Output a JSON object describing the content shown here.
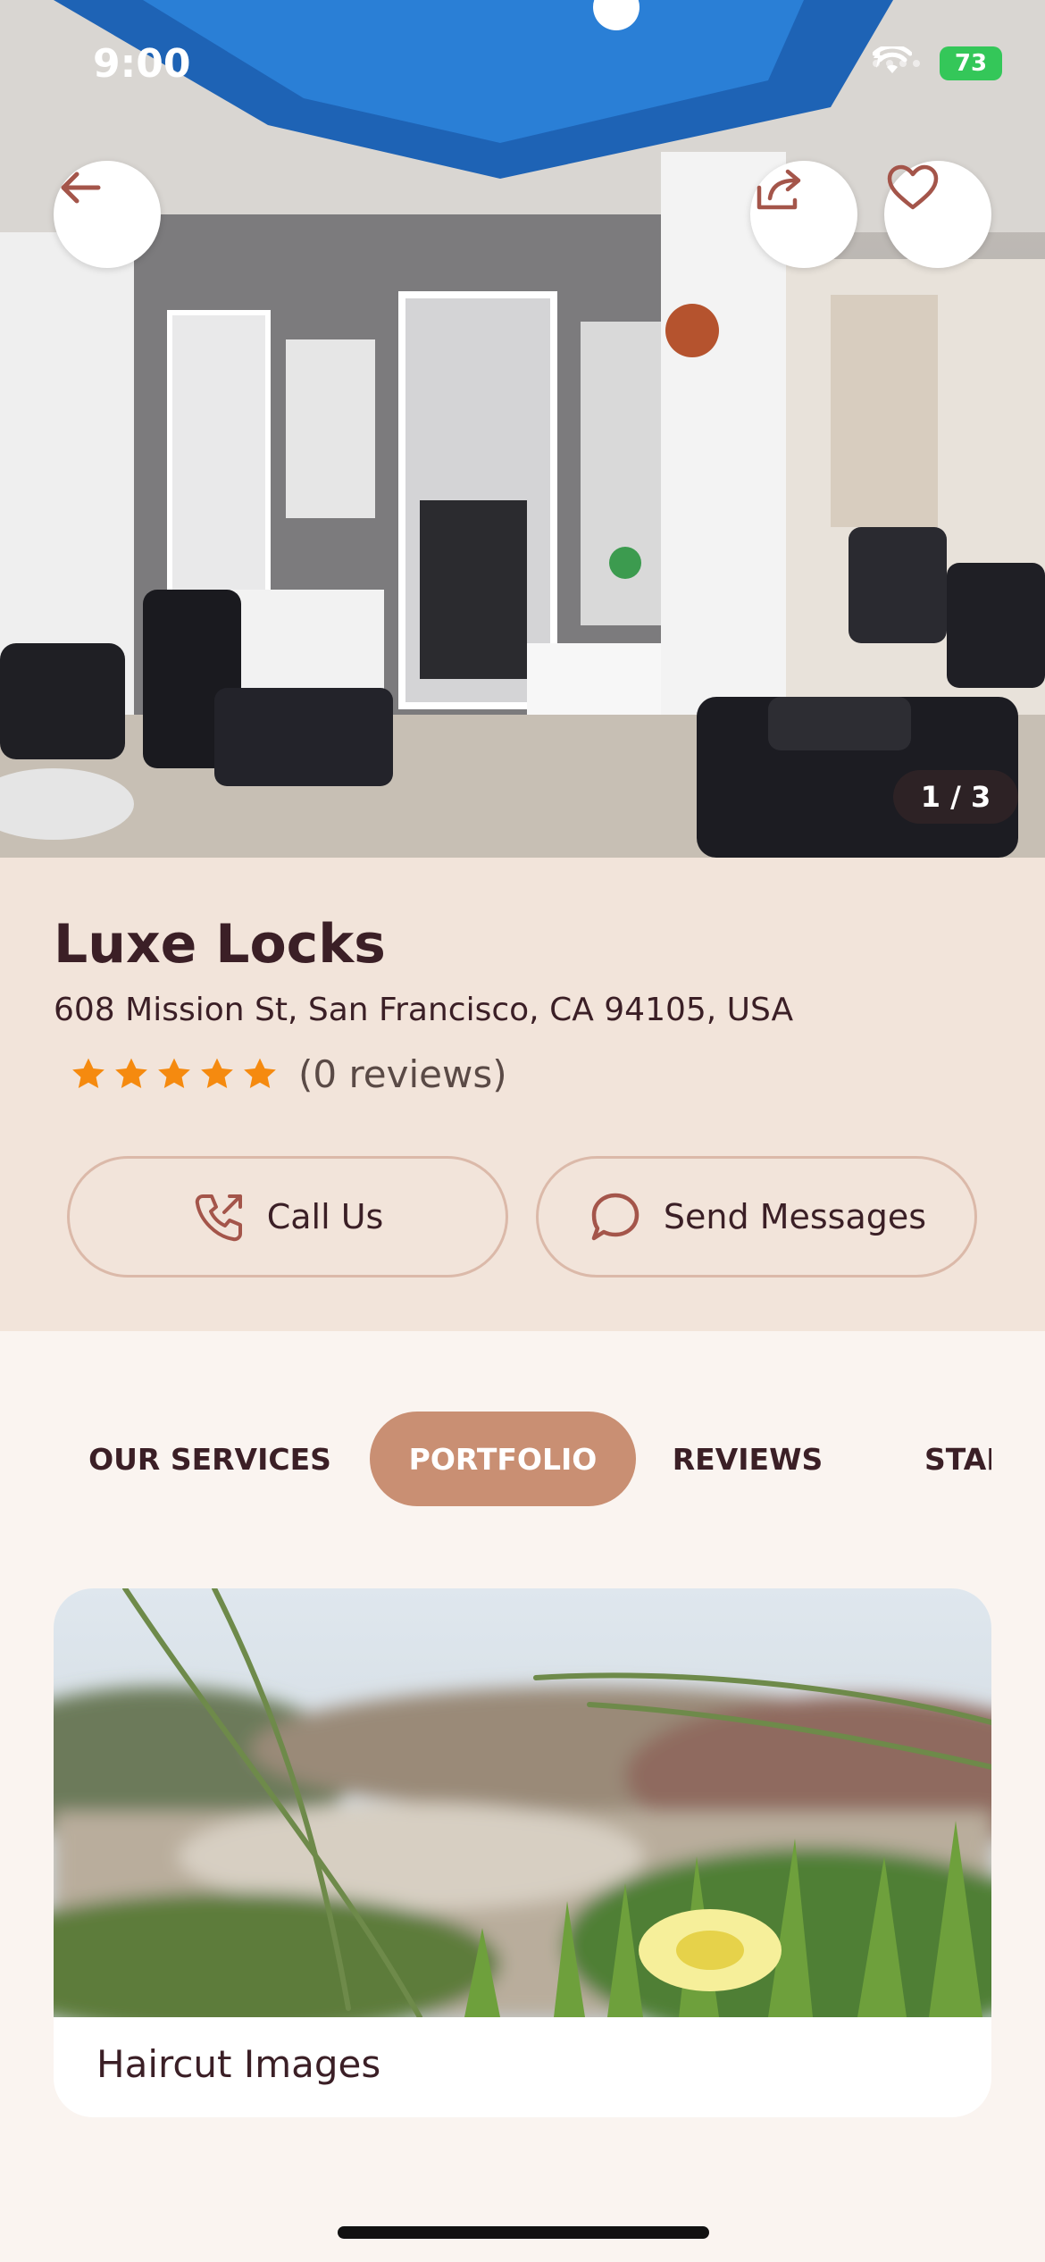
{
  "status_bar": {
    "time": "9:00",
    "battery": "73"
  },
  "hero": {
    "photo_counter": "1 / 3",
    "back_icon": "arrow-left-icon",
    "share_icon": "share-icon",
    "favorite_icon": "heart-icon"
  },
  "shop": {
    "name": "Luxe Locks",
    "address": "608 Mission St, San Francisco, CA 94105, USA",
    "rating_stars": 5,
    "reviews_label": "(0 reviews)"
  },
  "actions": {
    "call_label": "Call Us",
    "message_label": "Send Messages"
  },
  "tabs": [
    {
      "label": "OUR SERVICES",
      "active": false
    },
    {
      "label": "PORTFOLIO",
      "active": true
    },
    {
      "label": "REVIEWS",
      "active": false
    },
    {
      "label": "STAFF",
      "active": false
    }
  ],
  "portfolio": {
    "items": [
      {
        "title": "Haircut Images"
      }
    ]
  },
  "colors": {
    "accent": "#c98f73",
    "info_background": "#f2e4da",
    "page_background": "#faf4f0",
    "star": "#f58a0f",
    "text": "#3b1f26"
  }
}
